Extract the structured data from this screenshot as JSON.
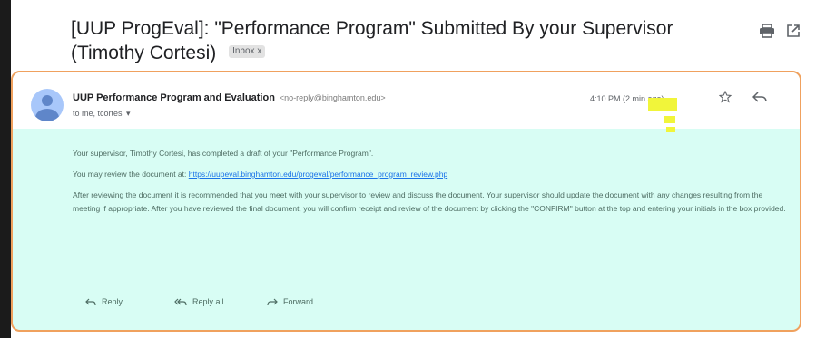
{
  "subject": {
    "title": "[UUP ProgEval]: \"Performance Program\" Submitted By your Supervisor (Timothy Cortesi)",
    "label_chip": "Inbox x"
  },
  "icons": {
    "print": "print-icon",
    "open_new_window": "open-in-new-icon",
    "star": "star-icon",
    "reply": "reply-icon",
    "reply_all": "reply-all-icon",
    "forward": "forward-icon",
    "avatar": "person-avatar-icon"
  },
  "message": {
    "sender_name": "UUP Performance Program and Evaluation",
    "sender_email": "<no-reply@binghamton.edu>",
    "recipient": "to me, tcortesi",
    "time": "4:10 PM (2 min ago)",
    "body": {
      "p1": "Your supervisor, Timothy Cortesi, has completed a draft of your \"Performance Program\".",
      "p2_prefix": "You may review the document at:",
      "p2_link": "https://uupeval.binghamton.edu/progeval/performance_program_review.php",
      "p3": "After reviewing the document it is recommended that you meet with your supervisor to review and discuss the document. Your supervisor should update the document with any changes resulting from the meeting if appropriate. After you have reviewed the final document, you will confirm receipt and review of the document by clicking the \"CONFIRM\" button at the top and entering your initials in the box provided."
    },
    "actions": {
      "reply": "Reply",
      "reply_all": "Reply all",
      "forward": "Forward"
    }
  },
  "colors": {
    "message_background": "#d8fdf4",
    "card_border": "#f0a15e",
    "highlight": "#f1f53a",
    "link": "#1a73e8"
  }
}
